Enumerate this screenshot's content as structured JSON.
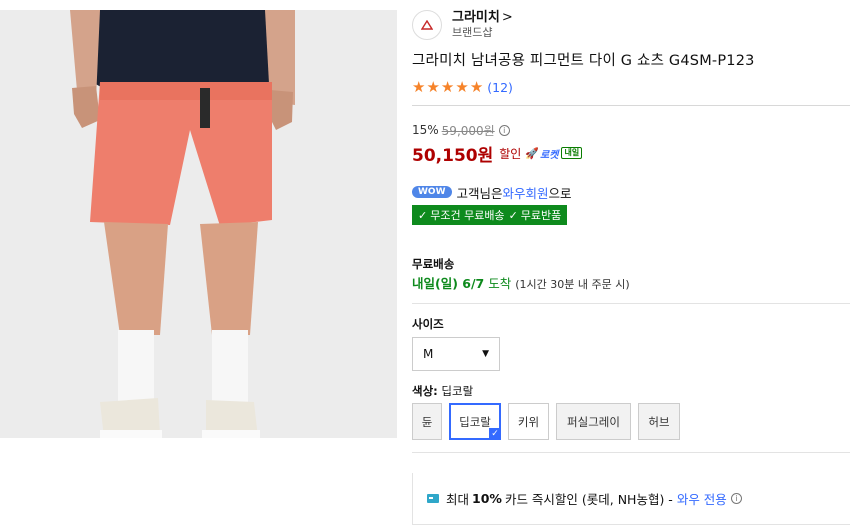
{
  "brand": {
    "name": "그라미치",
    "chevron": ">",
    "sub": "브랜드샵",
    "logo_icon": "brand-logo-icon"
  },
  "product": {
    "title": "그라미치 남녀공용 피그먼트 다이 G 쇼츠 G4SM-P123"
  },
  "rating": {
    "stars": 5,
    "review_count": "(12)"
  },
  "price": {
    "discount_percent": "15%",
    "original": "59,000원",
    "info_icon": "ⓘ",
    "sale": "50,150원",
    "sale_tag": "할인",
    "rocket_label": "로켓",
    "rocket_badge": "내일"
  },
  "wow": {
    "badge": "WOW",
    "text_before": "고객님은 ",
    "link": "와우회원",
    "text_after": "으로",
    "free_ship": "무조건 무료배송",
    "free_return": "무료반품"
  },
  "shipping": {
    "label": "무료배송",
    "arrival_day": "내일(일) 6/7",
    "arrival_word": "도착",
    "note": "(1시간 30분 내 주문 시)"
  },
  "size": {
    "label": "사이즈",
    "selected": "M"
  },
  "color": {
    "label": "색상:",
    "selected_name": "딥코랄",
    "options": [
      "듄",
      "딥코랄",
      "키위",
      "퍼실그레이",
      "허브"
    ]
  },
  "card": {
    "prefix": "최대",
    "pct": "10%",
    "text": "카드 즉시할인 (롯데, NH농협) -",
    "wow_only": "와우 전용",
    "info_icon": "ⓘ"
  },
  "colors": {
    "accent": "#346aff",
    "price_red": "#ae0000",
    "green": "#0e8a1d",
    "star": "#f6832a",
    "shorts": "#ee7e6c"
  }
}
